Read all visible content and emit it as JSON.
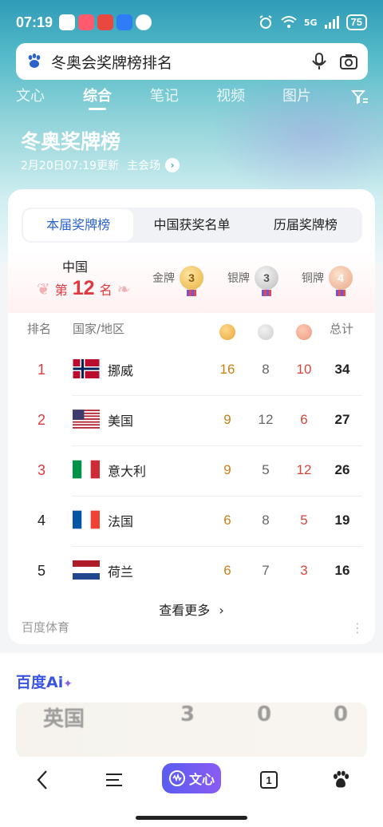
{
  "status_bar": {
    "time": "07:19",
    "network": "5G",
    "battery": "75"
  },
  "search": {
    "query": "冬奥会奖牌榜排名"
  },
  "tabs": [
    "文心",
    "综合",
    "笔记",
    "视频",
    "图片"
  ],
  "hero": {
    "title": "冬奥奖牌榜",
    "subtitle": "2月20日07:19更新",
    "venue_link": "主会场"
  },
  "segments": [
    "本届奖牌榜",
    "中国获奖名单",
    "历届奖牌榜"
  ],
  "china": {
    "name": "中国",
    "rank_prefix": "第",
    "rank": "12",
    "rank_suffix": "名",
    "gold_label": "金牌",
    "gold": "3",
    "silver_label": "银牌",
    "silver": "3",
    "bronze_label": "铜牌",
    "bronze": "4"
  },
  "table": {
    "headers": {
      "rank": "排名",
      "country": "国家/地区",
      "total": "总计"
    },
    "rows": [
      {
        "rank": "1",
        "country": "挪威",
        "gold": "16",
        "silver": "8",
        "bronze": "10",
        "total": "34"
      },
      {
        "rank": "2",
        "country": "美国",
        "gold": "9",
        "silver": "12",
        "bronze": "6",
        "total": "27"
      },
      {
        "rank": "3",
        "country": "意大利",
        "gold": "9",
        "silver": "5",
        "bronze": "12",
        "total": "26"
      },
      {
        "rank": "4",
        "country": "法国",
        "gold": "6",
        "silver": "8",
        "bronze": "5",
        "total": "19"
      },
      {
        "rank": "5",
        "country": "荷兰",
        "gold": "6",
        "silver": "7",
        "bronze": "3",
        "total": "16"
      }
    ],
    "see_more": "查看更多"
  },
  "source": "百度体育",
  "ai": {
    "logo": "百度Ai",
    "preview": {
      "country": "英国",
      "gold": "3",
      "silver": "0",
      "bronze": "0"
    }
  },
  "bottom_nav": {
    "wenxin": "文心",
    "tab_count": "1"
  },
  "colors": {
    "accent": "#2b63c9",
    "rank_red": "#e0383e",
    "gold": "#c88018",
    "bronze": "#d6453c"
  }
}
